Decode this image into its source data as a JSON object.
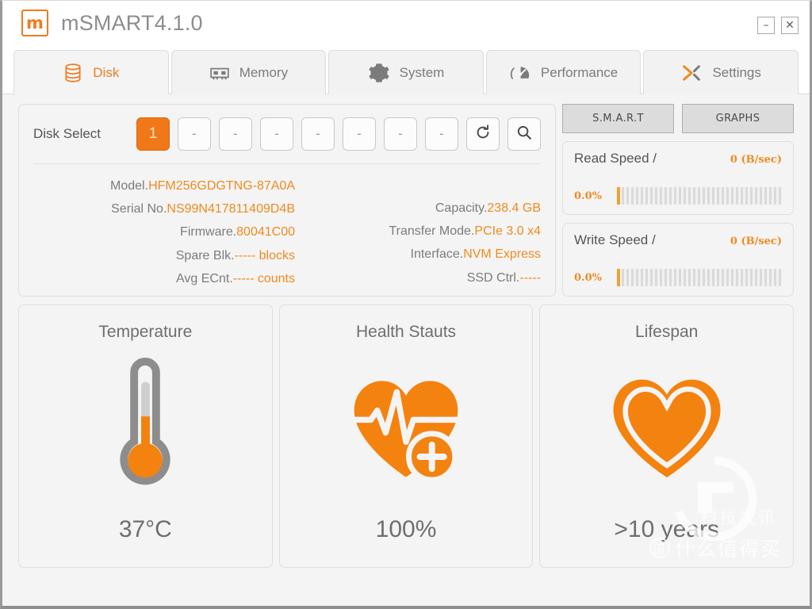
{
  "app": {
    "logo_letter": "m",
    "title": "mSMART4.1.0"
  },
  "window_controls": {
    "minimize": "–",
    "close": "✕"
  },
  "tabs": [
    {
      "label": "Disk",
      "icon": "database-icon",
      "active": true
    },
    {
      "label": "Memory",
      "icon": "ram-chip-icon",
      "active": false
    },
    {
      "label": "System",
      "icon": "gear-icon",
      "active": false
    },
    {
      "label": "Performance",
      "icon": "gauge-icon",
      "active": false
    },
    {
      "label": "Settings",
      "icon": "wrench-cross-icon",
      "active": false
    }
  ],
  "disk_select": {
    "label": "Disk Select",
    "slots": [
      "1",
      "-",
      "-",
      "-",
      "-",
      "-",
      "-",
      "-"
    ],
    "active_index": 0,
    "refresh_icon": "refresh-icon",
    "search_icon": "search-icon"
  },
  "disk_info": {
    "left": [
      {
        "key": "Model.",
        "value": "HFM256GDGTNG-87A0A"
      },
      {
        "key": "Serial No.",
        "value": "NS99N417811409D4B"
      },
      {
        "key": "Firmware.",
        "value": "80041C00"
      },
      {
        "key": "Spare Blk.",
        "value": "----- blocks"
      },
      {
        "key": "Avg ECnt.",
        "value": "----- counts"
      }
    ],
    "right": [
      {
        "key": "Capacity.",
        "value": "238.4 GB"
      },
      {
        "key": "Transfer Mode.",
        "value": "PCIe 3.0 x4"
      },
      {
        "key": "Interface.",
        "value": "NVM Express"
      },
      {
        "key": "SSD Ctrl.",
        "value": "-----"
      }
    ]
  },
  "side_buttons": {
    "smart": "S.M.A.R.T",
    "graphs": "GRAPHS"
  },
  "speeds": [
    {
      "title": "Read Speed /",
      "value": "0 (B/sec)",
      "percent": "0.0%"
    },
    {
      "title": "Write Speed /",
      "value": "0 (B/sec)",
      "percent": "0.0%"
    }
  ],
  "cards": [
    {
      "title": "Temperature",
      "value": "37°C",
      "icon": "thermometer-icon"
    },
    {
      "title": "Health Stauts",
      "value": "100%",
      "icon": "heart-pulse-icon"
    },
    {
      "title": "Lifespan",
      "value": ">10 years",
      "icon": "heart-outline-icon"
    }
  ],
  "watermark": {
    "line1": "科技视讯",
    "badge": "值",
    "line2": "什么值得买"
  },
  "colors": {
    "accent": "#f07818",
    "accent_text": "#f08a1e",
    "panel_bg": "#f4f4f4",
    "muted_text": "#7c7c7c"
  }
}
